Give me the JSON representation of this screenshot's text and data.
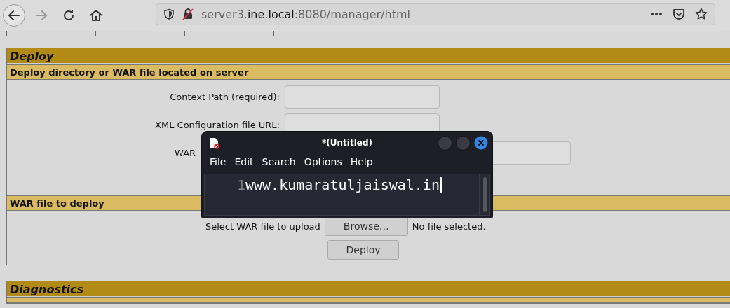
{
  "browser": {
    "nav_buttons": [
      {
        "kind": "back",
        "disabled": false
      },
      {
        "kind": "forward",
        "disabled": true
      },
      {
        "kind": "reload",
        "disabled": false
      },
      {
        "kind": "home",
        "disabled": false
      }
    ],
    "url": {
      "prefix": "server3.",
      "domain": "ine.local",
      "suffix": ":8080/manager/html"
    }
  },
  "deploy": {
    "title": "Deploy",
    "server_section": {
      "title": "Deploy directory or WAR file located on server",
      "fields": [
        {
          "label": "Context Path (required):",
          "kind": "full",
          "wide": false
        },
        {
          "label": "XML Configuration file URL:",
          "kind": "full",
          "wide": false
        },
        {
          "label": "WAR",
          "kind": "clipped",
          "wide": true
        }
      ]
    },
    "war_section": {
      "title": "WAR file to deploy",
      "upload_label": "Select WAR file to upload",
      "browse_button": "Browse…",
      "file_status": "No file selected.",
      "deploy_button": "Deploy"
    }
  },
  "diagnostics": {
    "title": "Diagnostics"
  },
  "editor": {
    "title": "*(Untitled)",
    "menu": [
      "File",
      "Edit",
      "Search",
      "Options",
      "Help"
    ],
    "lines": [
      {
        "number": "1",
        "text": "www.kumaratuljaiswal.in"
      }
    ]
  }
}
